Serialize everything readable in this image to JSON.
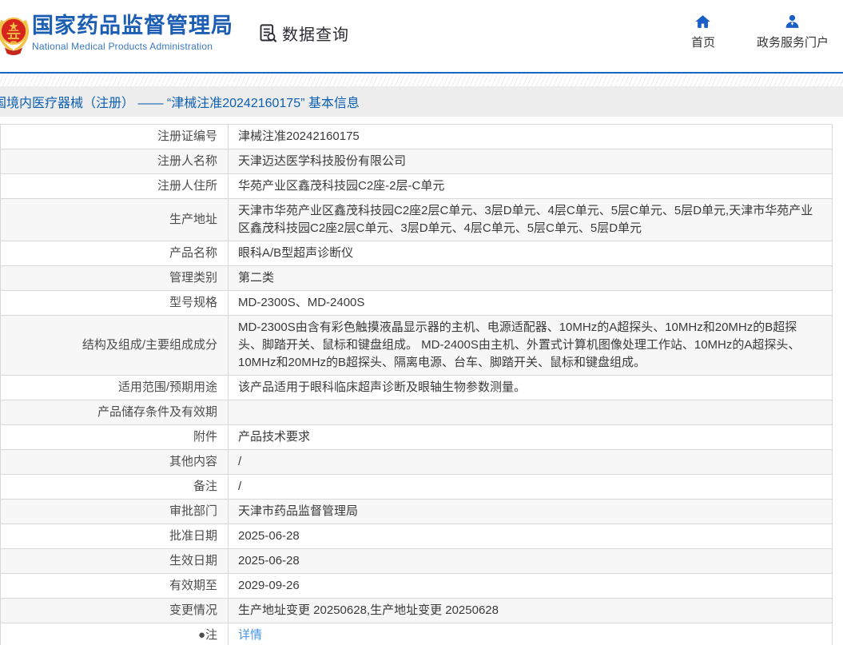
{
  "header": {
    "org_name_zh": "国家药品监督管理局",
    "org_name_en": "National Medical Products Administration",
    "data_query_label": "数据查询",
    "nav_home_label": "首页",
    "nav_portal_label": "政务服务门户"
  },
  "breadcrumb": {
    "title": "国境内医疗器械（注册） —— “津械注准20242160175” 基本信息"
  },
  "detail_table": {
    "rows": [
      {
        "label": "注册证编号",
        "value": "津械注准20242160175"
      },
      {
        "label": "注册人名称",
        "value": "天津迈达医学科技股份有限公司"
      },
      {
        "label": "注册人住所",
        "value": "华苑产业区鑫茂科技园C2座-2层-C单元"
      },
      {
        "label": "生产地址",
        "value": "天津市华苑产业区鑫茂科技园C2座2层C单元、3层D单元、4层C单元、5层C单元、5层D单元,天津市华苑产业区鑫茂科技园C2座2层C单元、3层D单元、4层C单元、5层C单元、5层D单元"
      },
      {
        "label": "产品名称",
        "value": "眼科A/B型超声诊断仪"
      },
      {
        "label": "管理类别",
        "value": "第二类"
      },
      {
        "label": "型号规格",
        "value": "MD-2300S、MD-2400S"
      },
      {
        "label": "结构及组成/主要组成成分",
        "value": "MD-2300S由含有彩色触摸液晶显示器的主机、电源适配器、10MHz的A超探头、10MHz和20MHz的B超探头、脚踏开关、鼠标和键盘组成。 MD-2400S由主机、外置式计算机图像处理工作站、10MHz的A超探头、10MHz和20MHz的B超探头、隔离电源、台车、脚踏开关、鼠标和键盘组成。"
      },
      {
        "label": "适用范围/预期用途",
        "value": "该产品适用于眼科临床超声诊断及眼轴生物参数测量。"
      },
      {
        "label": "产品储存条件及有效期",
        "value": ""
      },
      {
        "label": "附件",
        "value": "产品技术要求"
      },
      {
        "label": "其他内容",
        "value": "/"
      },
      {
        "label": "备注",
        "value": "/"
      },
      {
        "label": "审批部门",
        "value": "天津市药品监督管理局"
      },
      {
        "label": "批准日期",
        "value": "2025-06-28"
      },
      {
        "label": "生效日期",
        "value": "2025-06-28"
      },
      {
        "label": "有效期至",
        "value": "2029-09-26"
      },
      {
        "label": "变更情况",
        "value": "生产地址变更 20250628,生产地址变更 20250628"
      },
      {
        "label": "●注",
        "value": "详情",
        "link": true
      }
    ]
  },
  "colors": {
    "brand_blue": "#1c5eb3",
    "accent_line_blue": "#1568c8",
    "breadcrumb_blue": "#0c5fb0",
    "link_blue": "#4596e0",
    "icon_blue": "#1a5fc8",
    "alt_row_bg": "#f7f7f7",
    "border_gray": "#d8d8d8"
  }
}
